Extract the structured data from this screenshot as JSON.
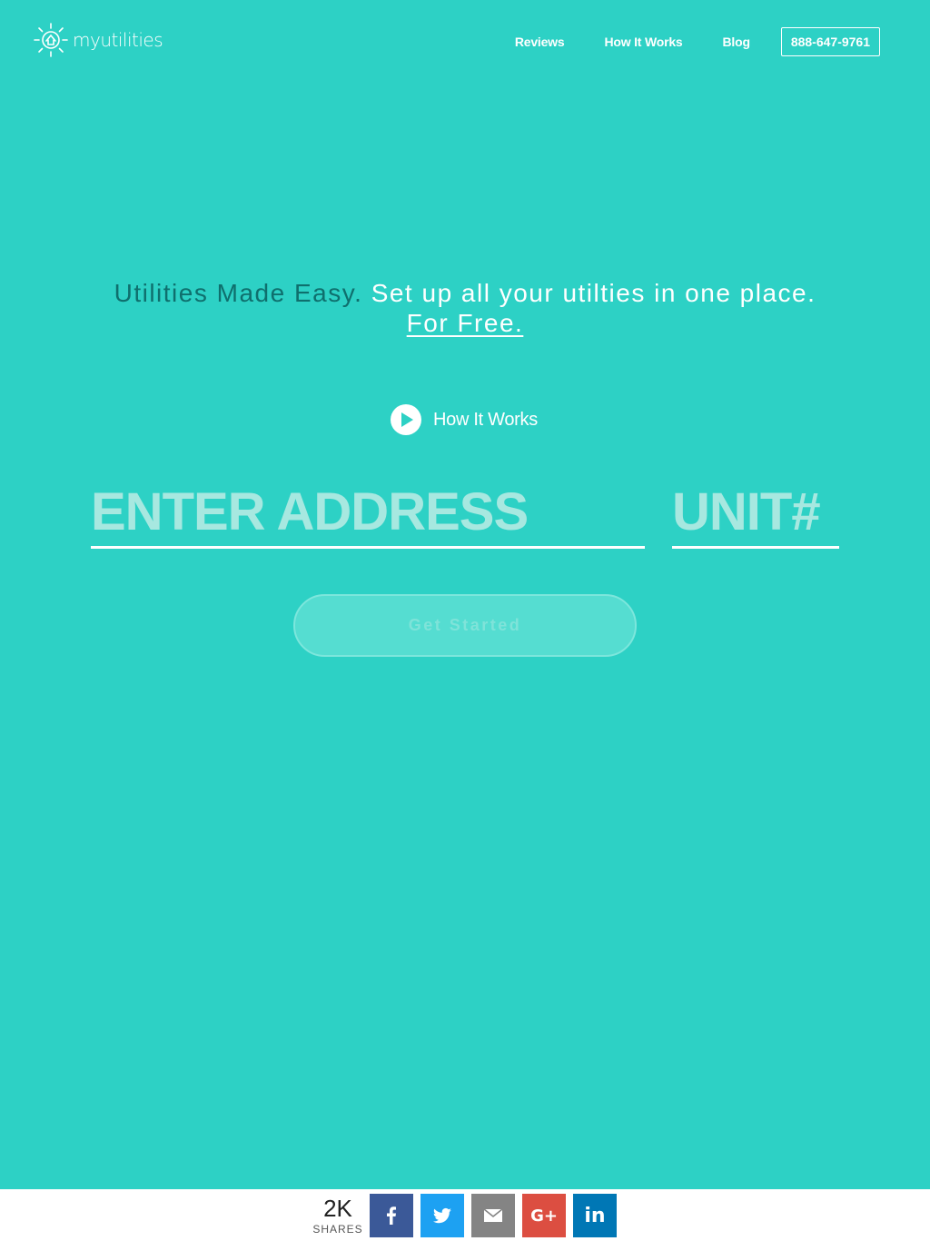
{
  "header": {
    "logo_text": "myutilities",
    "nav": [
      "Reviews",
      "How It Works",
      "Blog"
    ],
    "phone": "888-647-9761"
  },
  "hero": {
    "tagline_dark": "Utilities Made Easy.",
    "tagline_light": "Set up all your utilties in one place.",
    "tagline_link": "For Free.",
    "how_it_works": "How It Works",
    "address_placeholder": "ENTER ADDRESS",
    "unit_placeholder": "UNIT#",
    "cta": "Get Started"
  },
  "share_bar": {
    "count": "2K",
    "label": "SHARES",
    "buttons": [
      {
        "name": "facebook",
        "color": "#3b5998"
      },
      {
        "name": "twitter",
        "color": "#1da1f2"
      },
      {
        "name": "email",
        "color": "#848484"
      },
      {
        "name": "google-plus",
        "color": "#dc4e41",
        "text": "G+"
      },
      {
        "name": "linkedin",
        "color": "#0077b5",
        "text": "in"
      }
    ]
  },
  "colors": {
    "background": "#2dd1c5",
    "accent_dark": "#0f6f6d",
    "placeholder": "#a7e8e0"
  }
}
